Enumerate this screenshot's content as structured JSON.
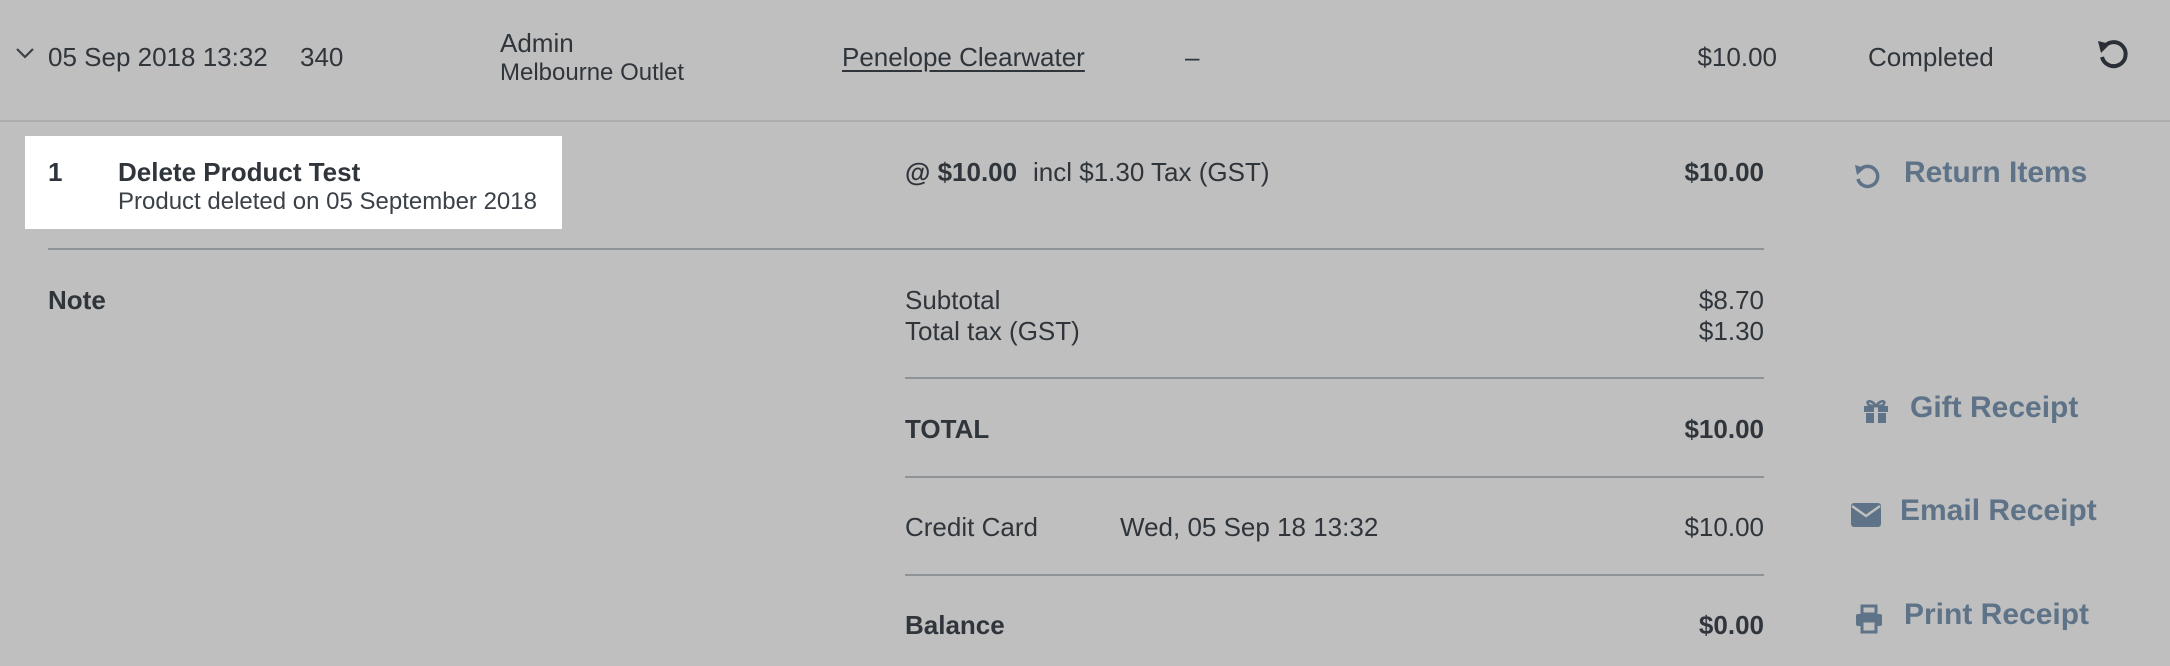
{
  "sale": {
    "datetime": "05 Sep 2018 13:32",
    "receipt_number": "340",
    "user": "Admin",
    "outlet": "Melbourne Outlet",
    "customer": "Penelope Clearwater",
    "note_dash": "–",
    "total": "$10.00",
    "status": "Completed"
  },
  "item": {
    "quantity": "1",
    "name": "Delete Product Test",
    "note": "Product deleted on 05 September 2018",
    "unit_price": "@ $10.00",
    "tax_info": "incl $1.30 Tax (GST)",
    "line_total": "$10.00"
  },
  "summary": {
    "note_label": "Note",
    "subtotal_label": "Subtotal",
    "subtotal_value": "$8.70",
    "tax_label": "Total tax (GST)",
    "tax_value": "$1.30",
    "total_label": "TOTAL",
    "total_value": "$10.00",
    "payment_method": "Credit Card",
    "payment_date": "Wed, 05 Sep 18 13:32",
    "payment_amount": "$10.00",
    "balance_label": "Balance",
    "balance_value": "$0.00"
  },
  "actions": {
    "return_items": "Return Items",
    "gift_receipt": "Gift Receipt",
    "email_receipt": "Email Receipt",
    "print_receipt": "Print Receipt"
  },
  "icons": {
    "expand": "chevron-down-icon",
    "undo": "undo-icon",
    "return": "undo-icon",
    "gift": "gift-icon",
    "email": "envelope-icon",
    "print": "printer-icon"
  },
  "colors": {
    "background": "#bfbfbf",
    "text": "#2f353b",
    "action": "#5e7388",
    "item_highlight": "#ffffff"
  }
}
